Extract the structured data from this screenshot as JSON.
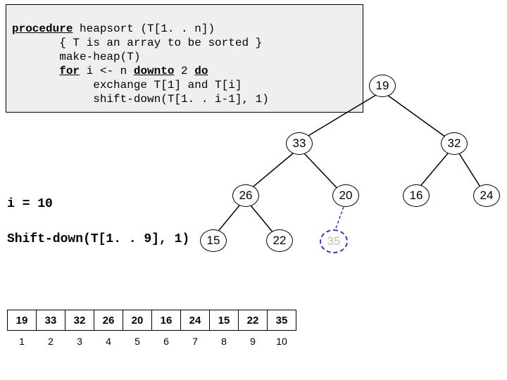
{
  "code": {
    "l1a": "procedure",
    "l1b": " heapsort (T[1. . n])",
    "l2": "       { T is an array to be sorted }",
    "l3": "       make-heap(T)",
    "l4a": "       ",
    "l4b": "for",
    "l4c": " i <- n ",
    "l4d": "downto",
    "l4e": " 2 ",
    "l4f": "do",
    "l5": "            exchange T[1] and T[i]",
    "l6": "            shift-down(T[1. . i-1], 1)"
  },
  "state": {
    "i": "i = 10",
    "call": "Shift-down(T[1. . 9], 1)"
  },
  "tree": {
    "n1": "19",
    "n2": "33",
    "n3": "32",
    "n4": "26",
    "n5": "20",
    "n6": "16",
    "n7": "24",
    "n8": "15",
    "n9": "22",
    "n10": "35"
  },
  "array": {
    "values": [
      "19",
      "33",
      "32",
      "26",
      "20",
      "16",
      "24",
      "15",
      "22",
      "35"
    ],
    "indices": [
      "1",
      "2",
      "3",
      "4",
      "5",
      "6",
      "7",
      "8",
      "9",
      "10"
    ]
  },
  "chart_data": {
    "type": "table",
    "title": "Heapsort step i=10 after exchange, before shift-down",
    "array": [
      19,
      33,
      32,
      26,
      20,
      16,
      24,
      15,
      22,
      35
    ],
    "indices": [
      1,
      2,
      3,
      4,
      5,
      6,
      7,
      8,
      9,
      10
    ],
    "tree_edges": [
      [
        1,
        2
      ],
      [
        1,
        3
      ],
      [
        2,
        4
      ],
      [
        2,
        5
      ],
      [
        3,
        6
      ],
      [
        3,
        7
      ],
      [
        4,
        8
      ],
      [
        4,
        9
      ],
      [
        5,
        10
      ]
    ],
    "removed_node": 10,
    "state": {
      "i": 10,
      "call": "Shift-down(T[1..9], 1)"
    }
  }
}
